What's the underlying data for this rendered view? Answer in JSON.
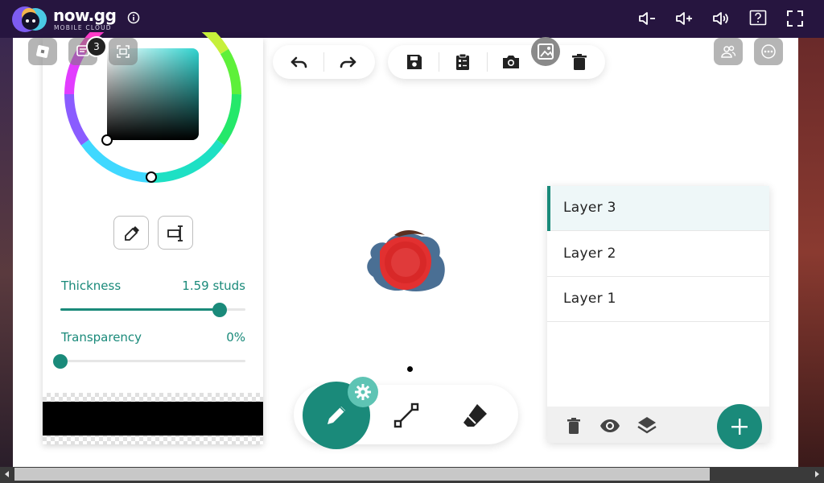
{
  "topbar": {
    "brand": "now.gg",
    "brand_sub": "MOBILE CLOUD",
    "icons": [
      "info-icon",
      "volume-down-icon",
      "volume-up-icon",
      "speaker-icon",
      "help-icon",
      "fullscreen-icon"
    ]
  },
  "roblox": {
    "chat_badge_count": "3",
    "icons": [
      "roblox-logo-icon",
      "chat-icon",
      "screenshot-mode-icon",
      "friends-icon",
      "more-icon"
    ]
  },
  "color_panel": {
    "thickness_label": "Thickness",
    "thickness_value": "1.59 studs",
    "thickness_fraction": 0.86,
    "transparency_label": "Transparency",
    "transparency_value": "0%",
    "transparency_fraction": 0.0,
    "current_color": "#000000",
    "tools": [
      "eyedropper-icon",
      "text-cursor-icon"
    ]
  },
  "toolbar": {
    "icons": [
      "undo-icon",
      "redo-icon",
      "save-icon",
      "clipboard-icon",
      "camera-icon",
      "image-icon",
      "trash-icon"
    ]
  },
  "draw_tools": [
    "pencil-icon",
    "line-icon",
    "eraser-icon"
  ],
  "layers": {
    "items": [
      {
        "label": "Layer 3",
        "active": true
      },
      {
        "label": "Layer 2",
        "active": false
      },
      {
        "label": "Layer 1",
        "active": false
      }
    ],
    "footer_icons": [
      "delete-layer-icon",
      "visibility-icon",
      "layers-icon",
      "add-layer-icon"
    ]
  },
  "colors": {
    "accent": "#1a8a7a",
    "topbar": "#26153f"
  }
}
